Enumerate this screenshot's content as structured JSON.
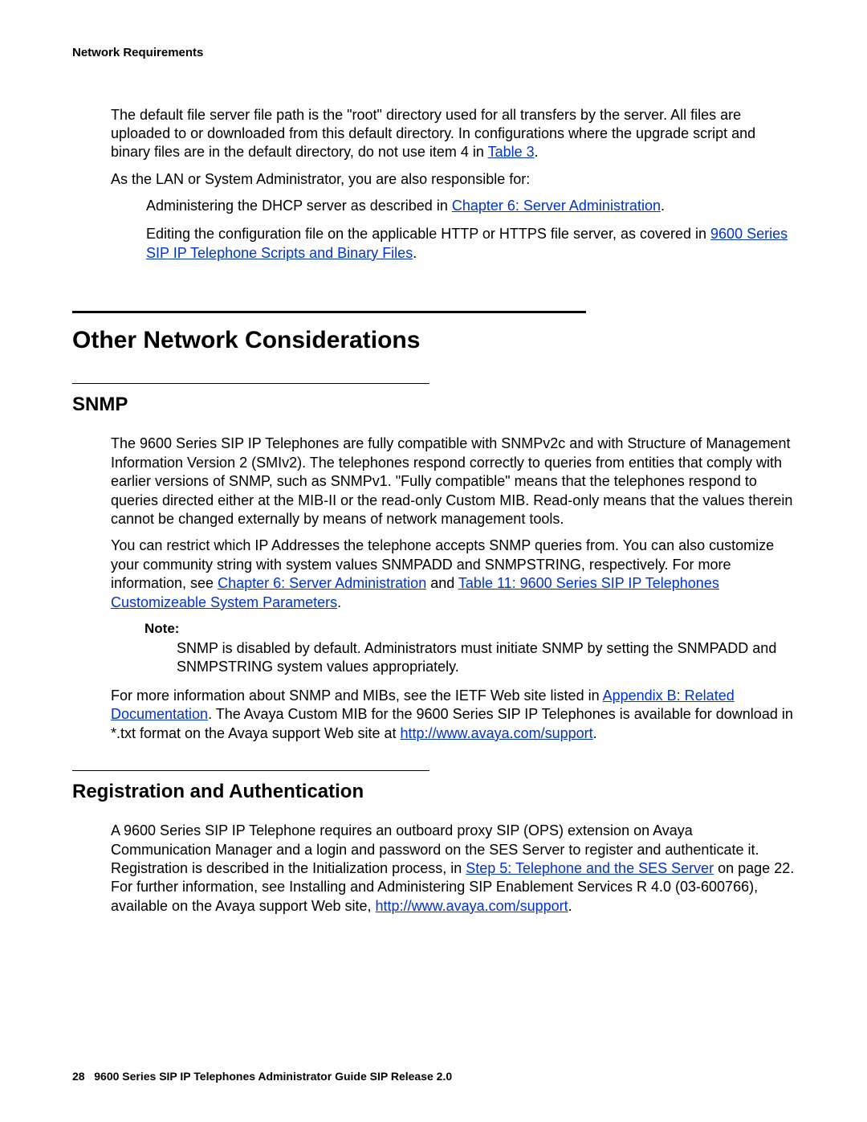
{
  "header": {
    "section": "Network Requirements"
  },
  "intro": {
    "p1_a": "The default file server file path is the \"root\" directory used for all transfers by the server. All files are uploaded to or downloaded from this default directory. In configurations where the upgrade script and binary files are in the default directory, do not use item 4 in ",
    "p1_link": "Table 3",
    "p1_b": ".",
    "p2": "As the LAN or System Administrator, you are also responsible for:",
    "list1_a": "Administering the DHCP server as described in ",
    "list1_link": "Chapter 6: Server Administration",
    "list1_b": ".",
    "list2_a": "Editing the configuration file on the applicable HTTP or HTTPS file server, as covered in ",
    "list2_link": "9600 Series SIP IP Telephone Scripts and Binary Files",
    "list2_b": "."
  },
  "h1": "Other Network Considerations",
  "snmp": {
    "title": "SNMP",
    "p1": "The 9600 Series SIP IP Telephones are fully compatible with SNMPv2c and with Structure of Management Information Version 2 (SMIv2). The telephones respond correctly to queries from entities that comply with earlier versions of SNMP, such as SNMPv1. \"Fully compatible\" means that the telephones respond to queries directed either at the MIB-II or the read-only Custom MIB. Read-only means that the values therein cannot be changed externally by means of network management tools.",
    "p2_a": "You can restrict which IP Addresses the telephone accepts SNMP queries from. You can also customize your community string with system values SNMPADD and SNMPSTRING, respectively. For more information, see ",
    "p2_link1": "Chapter 6: Server Administration",
    "p2_mid": " and ",
    "p2_link2": "Table 11:  9600 Series SIP IP Telephones Customizeable System Parameters",
    "p2_b": ".",
    "note_label": "Note:",
    "note_body": "SNMP is disabled by default. Administrators must initiate SNMP by setting the SNMPADD and SNMPSTRING system values appropriately.",
    "p3_a": "For more information about SNMP and MIBs, see the IETF Web site listed in ",
    "p3_link1": "Appendix B: Related Documentation",
    "p3_mid": ". The Avaya Custom MIB for the 9600 Series SIP IP Telephones is available for download in *.txt format on the Avaya support Web site at ",
    "p3_link2": "http://www.avaya.com/support",
    "p3_b": "."
  },
  "reg": {
    "title": "Registration and Authentication",
    "p1_a": "A 9600 Series SIP IP Telephone requires an outboard proxy SIP (OPS) extension on Avaya Communication Manager and a login and password on the SES Server to register and authenticate it. Registration is described in the Initialization process, in ",
    "p1_link1": "Step 5: Telephone and the SES Server",
    "p1_mid": " on page 22. For further information, see Installing and Administering SIP Enablement Services R 4.0 (03-600766), available on the Avaya support Web site, ",
    "p1_link2": "http://www.avaya.com/support",
    "p1_b": "."
  },
  "footer": {
    "page": "28",
    "title": "9600 Series SIP IP Telephones Administrator Guide SIP Release 2.0"
  }
}
